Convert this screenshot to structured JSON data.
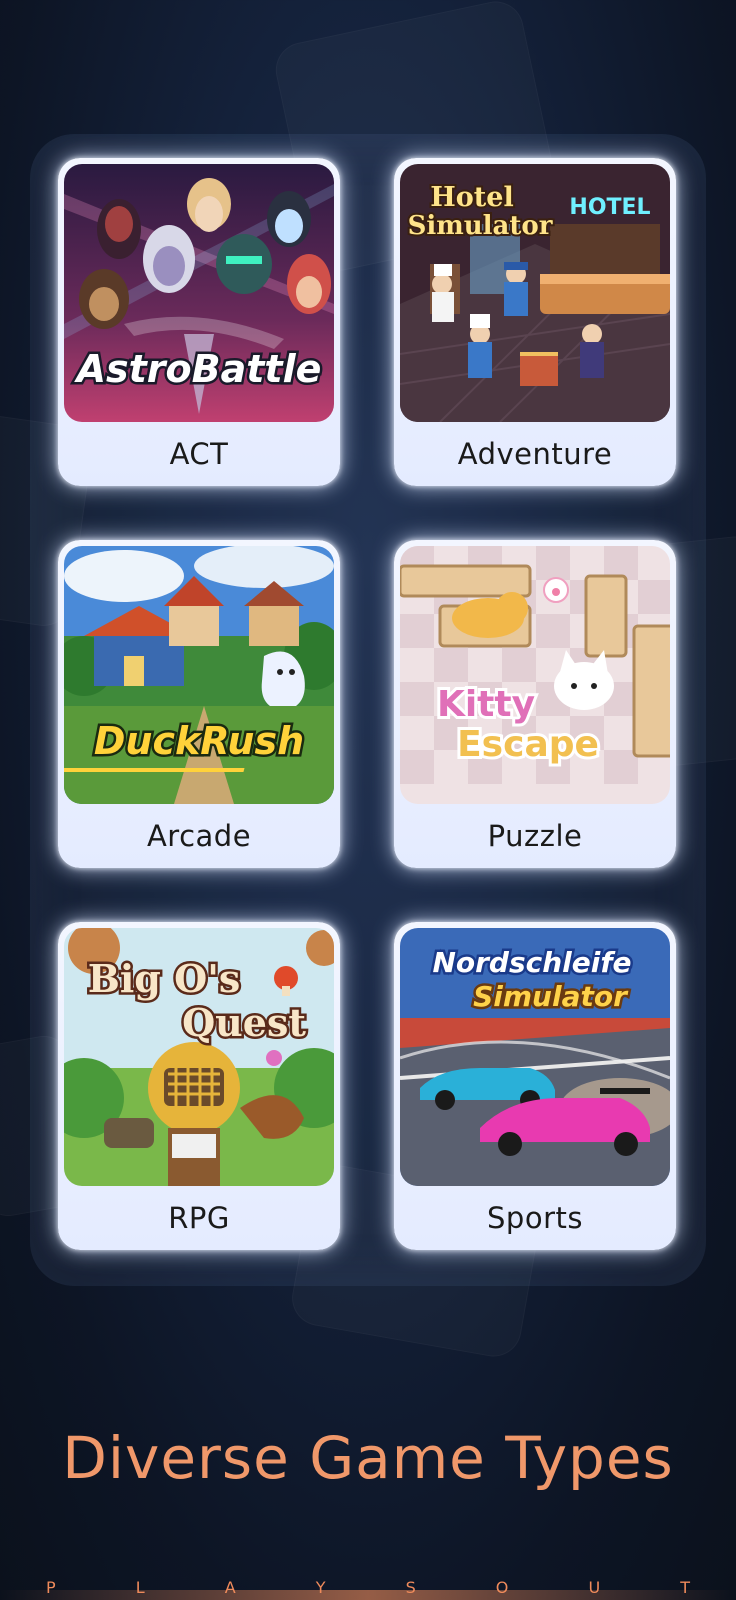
{
  "cards": [
    {
      "category": "ACT",
      "game_title": "AstroBattle"
    },
    {
      "category": "Adventure",
      "game_title_line1": "Hotel",
      "game_title_line2": "Simulator",
      "sign": "HOTEL"
    },
    {
      "category": "Arcade",
      "game_title": "DuckRush"
    },
    {
      "category": "Puzzle",
      "game_title_line1": "Kitty",
      "game_title_line2": "Escape"
    },
    {
      "category": "RPG",
      "game_title_line1": "Big O's",
      "game_title_line2": "Quest"
    },
    {
      "category": "Sports",
      "game_title_line1": "Nordschleife",
      "game_title_line2": "Simulator"
    }
  ],
  "headline": "Diverse Game Types",
  "brand_letters": [
    "P",
    "L",
    "A",
    "Y",
    "S",
    "O",
    "U",
    "T"
  ],
  "colors": {
    "accent": "#f0986a",
    "card_bg": "#eef2ff",
    "page_bg": "#14213a"
  }
}
